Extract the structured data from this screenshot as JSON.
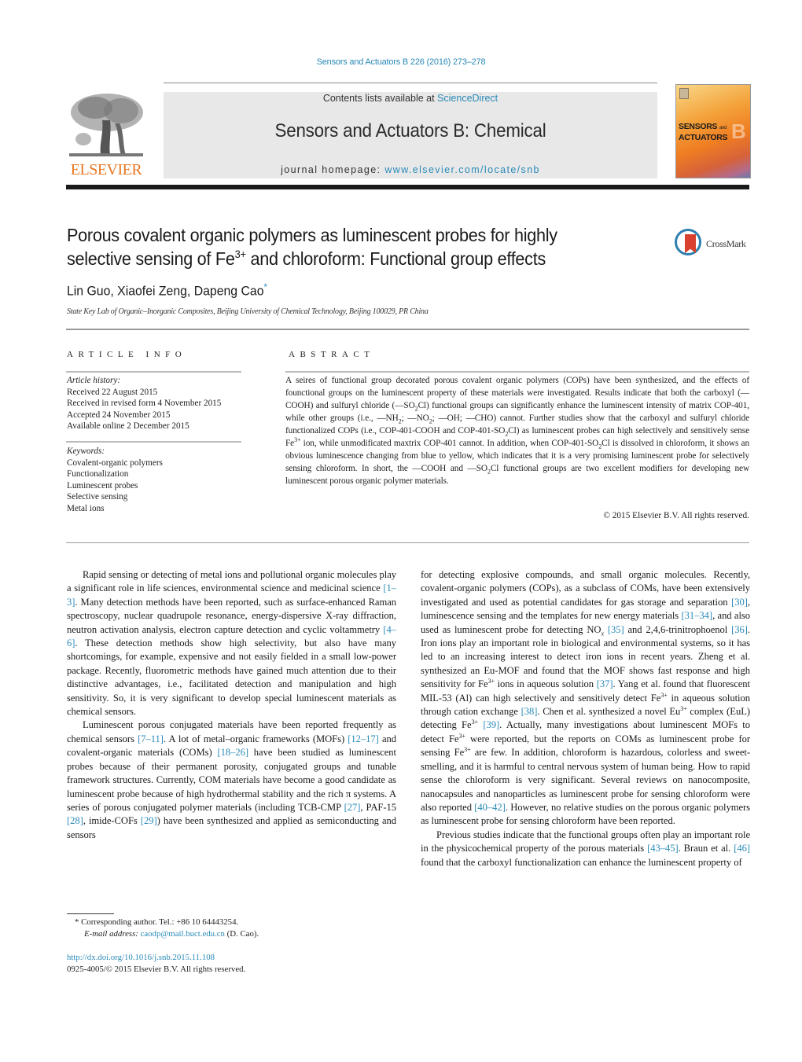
{
  "header": {
    "citation": "Sensors and Actuators B 226 (2016) 273–278",
    "contents_prefix": "Contents lists available at ",
    "contents_link": "ScienceDirect",
    "journal_title": "Sensors and Actuators B: Chemical",
    "homepage_prefix": "journal homepage: ",
    "homepage_link": "www.elsevier.com/locate/snb",
    "publisher_logo": "ELSEVIER",
    "cover": {
      "line1": "SENSORS",
      "and": "and",
      "line2": "ACTUATORS",
      "letter": "B"
    },
    "link_color": "#2a8ab8",
    "elsevier_color": "#e87722"
  },
  "article": {
    "title_part1": "Porous covalent organic polymers as luminescent probes for highly selective sensing of Fe",
    "title_sup": "3+",
    "title_part2": " and chloroform: Functional group effects",
    "crossmark_label": "CrossMark",
    "authors": "Lin Guo, Xiaofei Zeng, Dapeng Cao",
    "author_mark": "*",
    "affiliation": "State Key Lab of Organic–Inorganic Composites, Beijing University of Chemical Technology, Beijing 100029, PR China"
  },
  "article_info": {
    "heading": "ARTICLE INFO",
    "history_label": "Article history:",
    "history": [
      "Received 22 August 2015",
      "Received in revised form 4 November 2015",
      "Accepted 24 November 2015",
      "Available online 2 December 2015"
    ],
    "keywords_label": "Keywords:",
    "keywords": [
      "Covalent-organic polymers",
      "Functionalization",
      "Luminescent probes",
      "Selective sensing",
      "Metal ions"
    ]
  },
  "abstract": {
    "heading": "ABSTRACT",
    "s1": "A seires of functional group decorated porous covalent organic polymers (COPs) have been synthesized, and the effects of founctional groups on the luminescent property of these materials were investigated. Results indicate that both the carboxyl (—COOH) and sulfuryl chloride (—SO",
    "s1_sub": "2",
    "s2": "Cl) functional groups can significantly enhance the luminescent intensity of matrix COP-401, while other groups (i.e., —NH",
    "s2_sub": "2",
    "s3": "; —NO",
    "s3_sub": "2",
    "s4": "; —OH; —CHO) cannot. Further studies show that the carboxyl and sulfuryl chloride functionalized COPs (i.e., COP-401-COOH and COP-401-SO",
    "s4_sub": "2",
    "s5": "Cl) as luminescent probes can high selectively and sensitively sense Fe",
    "s5_sup": "3+",
    "s6": " ion, while unmodificated maxtrix COP-401 cannot. In addition, when COP-401-SO",
    "s6_sub": "2",
    "s7": "Cl is dissolved in chloroform, it shows an obvious luminescence changing from blue to yellow, which indicates that it is a very promising luminescent probe for selectively sensing chloroform. In short, the —COOH and —SO",
    "s7_sub": "2",
    "s8": "Cl functional groups are two excellent modifiers for developing new luminescent porous organic polymer materials.",
    "copyright": "© 2015 Elsevier B.V. All rights reserved."
  },
  "body": {
    "p1": {
      "a": "Rapid sensing or detecting of metal ions and pollutional organic molecules play a significant role in life sciences, environmental science and medicinal science ",
      "r1": "[1–3]",
      "b": ". Many detection methods have been reported, such as surface-enhanced Raman spectroscopy, nuclear quadrupole resonance, energy-dispersive X-ray diffraction, neutron activation analysis, electron capture detection and cyclic voltammetry ",
      "r2": "[4–6]",
      "c": ". These detection methods show high selectivity, but also have many shortcomings, for example, expensive and not easily fielded in a small low-power package. Recently, fluorometric methods have gained much attention due to their distinctive advantages, i.e., facilitated detection and manipulation and high sensitivity. So, it is very significant to develop special luminescent materials as chemical sensors."
    },
    "p2": {
      "a": "Luminescent porous conjugated materials have been reported frequently as chemical sensors ",
      "r1": "[7–11]",
      "b": ". A lot of metal–organic frameworks (MOFs) ",
      "r2": "[12–17]",
      "c": " and covalent-organic materials (COMs) ",
      "r3": "[18–26]",
      "d": " have been studied as luminescent probes because of their permanent porosity, conjugated groups and tunable framework structures. Currently, COM materials have become a good candidate as luminescent probe because of high hydrothermal stability and the rich π systems. A series of porous conjugated polymer materials (including TCB-CMP ",
      "r4": "[27]",
      "e": ", PAF-15 ",
      "r5": "[28]",
      "f": ", imide-COFs ",
      "r6": "[29]",
      "g": ") have been synthesized and applied as semiconducting and sensors"
    },
    "p3": {
      "a": "for detecting explosive compounds, and small organic molecules. Recently, covalent-organic polymers (COPs), as a subclass of COMs, have been extensively investigated and used as potential candidates for gas storage and separation ",
      "r1": "[30]",
      "b": ", luminescence sensing and the templates for new energy materials ",
      "r2": "[31–34]",
      "c": ", and also used as luminescent probe for detecting NO",
      "c_sub": "x",
      "c2": " ",
      "r3": "[35]",
      "d": " and 2,4,6-trinitrophoenol ",
      "r4": "[36]",
      "e": ". Iron ions play an important role in biological and environmental systems, so it has led to an increasing interest to detect iron ions in recent years. Zheng et al. synthesized an Eu-MOF and found that the MOF shows fast response and high sensitivity for Fe",
      "e_sup": "3+",
      "e2": " ions in aqueous solution ",
      "r5": "[37]",
      "f": ". Yang et al. found that fluorescent MIL-53 (Al) can high selectively and sensitively detect Fe",
      "f_sup": "3+",
      "f2": " in aqueous solution through cation exchange ",
      "r6": "[38]",
      "g": ". Chen et al. synthesized a novel Eu",
      "g_sup": "3+",
      "g2": " complex (EuL) detecting Fe",
      "g2_sup": "3+",
      "g3": " ",
      "r7": "[39]",
      "h": ". Actually, many investigations about luminescent MOFs to detect Fe",
      "h_sup": "3+",
      "h2": " were reported, but the reports on COMs as luminescent probe for sensing Fe",
      "h2_sup": "3+",
      "h3": " are few. In addition, chloroform is hazardous, colorless and sweet-smelling, and it is harmful to central nervous system of human being. How to rapid sense the chloroform is very significant. Several reviews on nanocomposite, nanocapsules and nanoparticles as luminescent probe for sensing chloroform were also reported ",
      "r8": "[40–42]",
      "i": ". However, no relative studies on the porous organic polymers as luminescent probe for sensing chloroform have been reported."
    },
    "p4": {
      "a": "Previous studies indicate that the functional groups often play an important role in the physicochemical property of the porous materials ",
      "r1": "[43–45]",
      "b": ". Braun et al. ",
      "r2": "[46]",
      "c": " found that the carboxyl functionalization can enhance the luminescent property of"
    }
  },
  "footnote": {
    "mark": "*",
    "corresponding": " Corresponding author. Tel.: +86 10 64443254.",
    "email_label": "E-mail address: ",
    "email": "caodp@mail.buct.edu.cn",
    "email_suffix": " (D. Cao).",
    "doi": "http://dx.doi.org/10.1016/j.snb.2015.11.108",
    "issn": "0925-4005/© 2015 Elsevier B.V. All rights reserved."
  }
}
